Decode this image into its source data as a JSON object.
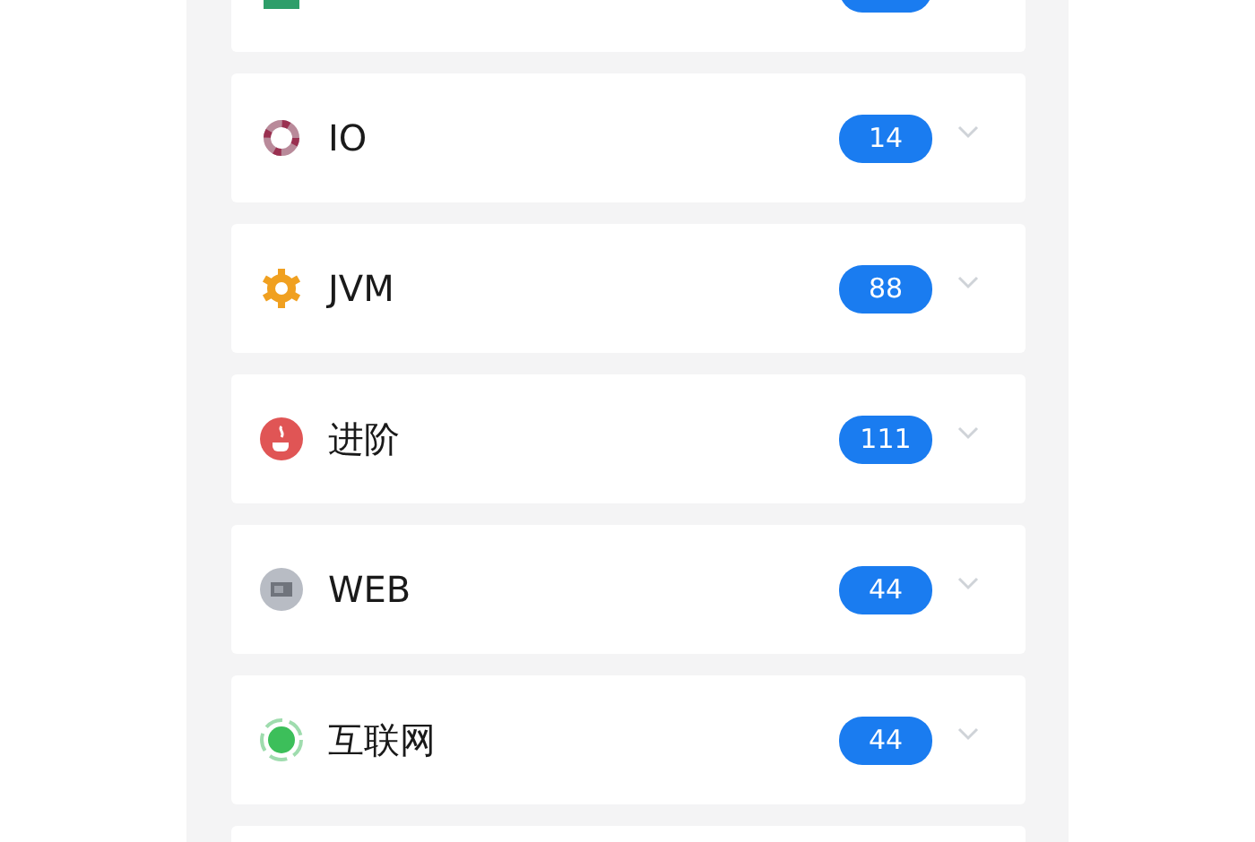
{
  "categories": [
    {
      "label": "IO",
      "count": "14"
    },
    {
      "label": "JVM",
      "count": "88"
    },
    {
      "label": "进阶",
      "count": "111"
    },
    {
      "label": "WEB",
      "count": "44"
    },
    {
      "label": "互联网",
      "count": "44"
    }
  ]
}
